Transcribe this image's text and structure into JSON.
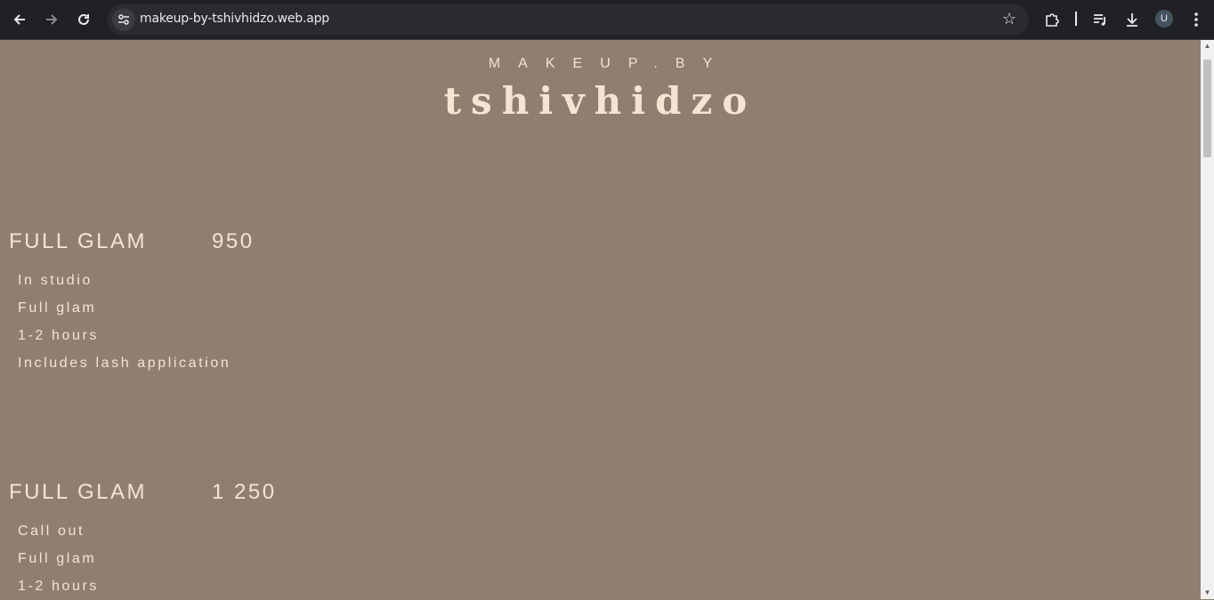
{
  "browser": {
    "url": "makeup-by-tshivhidzo.web.app",
    "profile_initial": "U",
    "icons": {
      "back": "back-arrow-icon",
      "forward": "forward-arrow-icon",
      "reload": "reload-icon",
      "site_info": "tune-icon",
      "bookmark": "star-icon",
      "extensions": "puzzle-icon",
      "media": "playlist-icon",
      "downloads": "download-icon",
      "menu": "kebab-menu-icon"
    }
  },
  "header": {
    "tagline": "MAKEUP.BY",
    "name": "tshivhidzo"
  },
  "packages": [
    {
      "title": "FULL GLAM",
      "price": "950",
      "items": [
        "In studio",
        "Full glam",
        "1-2 hours",
        "Includes lash application"
      ]
    },
    {
      "title": "FULL GLAM",
      "price": "1 250",
      "items": [
        "Call out",
        "Full glam",
        "1-2 hours"
      ]
    }
  ],
  "colors": {
    "background": "#8e7f72",
    "text": "#f3e2d2",
    "chrome": "#202124"
  }
}
